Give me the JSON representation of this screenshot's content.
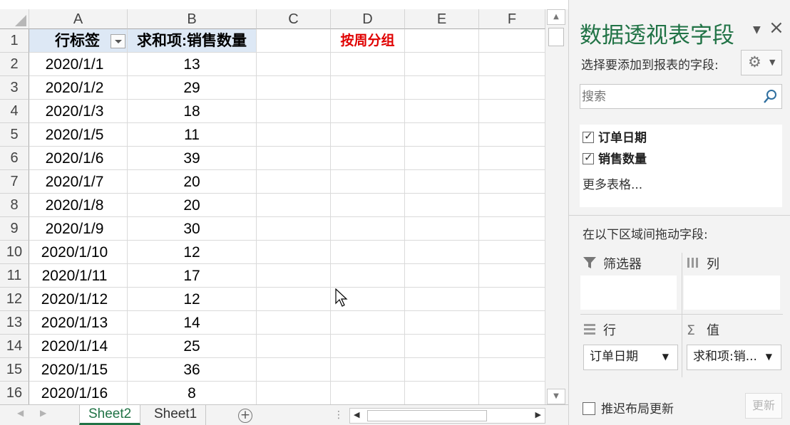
{
  "sheet": {
    "columns": [
      "A",
      "B",
      "C",
      "D",
      "E",
      "F"
    ],
    "rows": [
      "1",
      "2",
      "3",
      "4",
      "5",
      "6",
      "7",
      "8",
      "9",
      "10",
      "11",
      "12",
      "13",
      "14",
      "15",
      "16"
    ],
    "pivot_header": {
      "row_label": "行标签",
      "value_label": "求和项:销售数量"
    },
    "pivot_rows": [
      {
        "date": "2020/1/1",
        "qty": "13"
      },
      {
        "date": "2020/1/2",
        "qty": "29"
      },
      {
        "date": "2020/1/3",
        "qty": "18"
      },
      {
        "date": "2020/1/5",
        "qty": "11"
      },
      {
        "date": "2020/1/6",
        "qty": "39"
      },
      {
        "date": "2020/1/7",
        "qty": "20"
      },
      {
        "date": "2020/1/8",
        "qty": "20"
      },
      {
        "date": "2020/1/9",
        "qty": "30"
      },
      {
        "date": "2020/1/10",
        "qty": "12"
      },
      {
        "date": "2020/1/11",
        "qty": "17"
      },
      {
        "date": "2020/1/12",
        "qty": "12"
      },
      {
        "date": "2020/1/13",
        "qty": "14"
      },
      {
        "date": "2020/1/14",
        "qty": "25"
      },
      {
        "date": "2020/1/15",
        "qty": "36"
      },
      {
        "date": "2020/1/16",
        "qty": "8"
      }
    ],
    "d1_note": "按周分组",
    "tabs": [
      "Sheet2",
      "Sheet1"
    ],
    "active_tab": "Sheet2"
  },
  "panel": {
    "title": "数据透视表字段",
    "choose_label": "选择要添加到报表的字段:",
    "search_placeholder": "搜索",
    "fields": [
      {
        "label": "订单日期",
        "checked": true
      },
      {
        "label": "销售数量",
        "checked": true
      }
    ],
    "more_tables": "更多表格...",
    "drag_label": "在以下区域间拖动字段:",
    "areas": {
      "filters": "筛选器",
      "columns": "列",
      "rows": "行",
      "values": "值"
    },
    "rows_field": "订单日期",
    "values_field": "求和项:销...",
    "defer_label": "推迟布局更新",
    "update_button": "更新"
  },
  "colors": {
    "accent": "#217346",
    "header_fill": "#dde8f5",
    "note_red": "#e00000"
  }
}
